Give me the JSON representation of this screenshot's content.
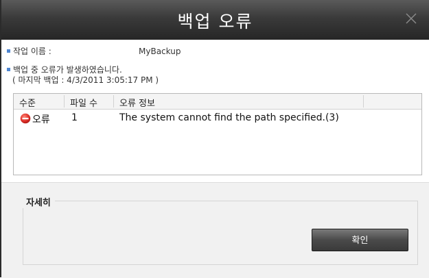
{
  "window": {
    "title": "백업 오류"
  },
  "info": {
    "job_name_label": "작업 이름 :",
    "job_name_value": "MyBackup",
    "error_message": "백업 중 오류가 발생하였습니다.",
    "last_backup": "( 마지막 백업 : 4/3/2011 3:05:17 PM )"
  },
  "table": {
    "columns": [
      "수준",
      "파일 수",
      "오류 정보"
    ],
    "rows": [
      {
        "level": "오류",
        "file_count": "1",
        "error_info": "The system cannot find the path specified.(3)",
        "icon": "error-icon"
      }
    ]
  },
  "details": {
    "label": "자세히"
  },
  "buttons": {
    "ok_label": "확인"
  },
  "colors": {
    "titlebar": "#333333",
    "bullet": "#4f86d1",
    "error_icon": "#d62b2b"
  }
}
